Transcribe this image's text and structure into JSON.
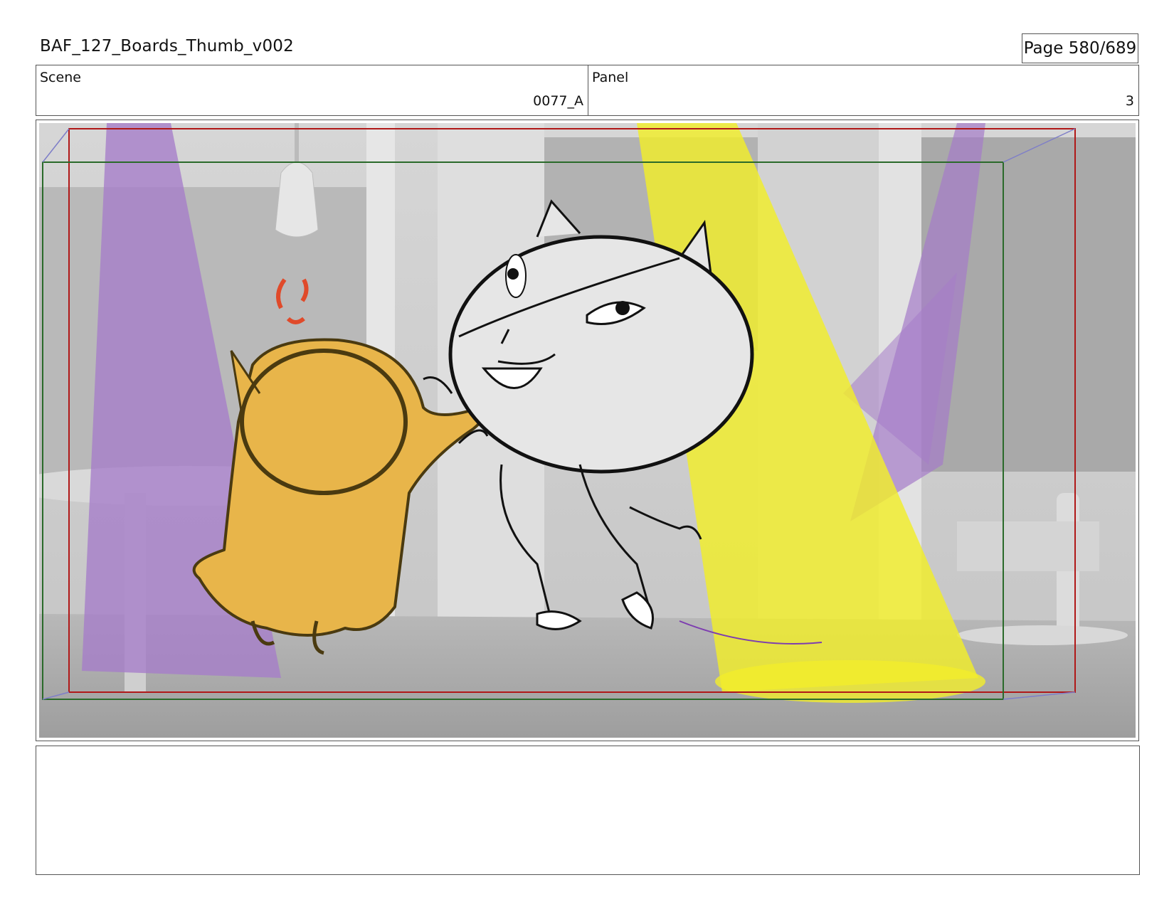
{
  "header": {
    "title": "BAF_127_Boards_Thumb_v002",
    "page": "Page 580/689"
  },
  "info": {
    "scene_label": "Scene",
    "scene_value": "0077_A",
    "panel_label": "Panel",
    "panel_value": "3"
  },
  "artwork": {
    "description_icon": "storyboard-sketch-icon",
    "colors": {
      "background_gray": "#c9c9c9",
      "purple_light": "#a57cc9",
      "yellow_light": "#f2ee2a",
      "orange_character": "#e8b54a",
      "safe_frame_red": "#b01818",
      "title_safe_green": "#2a6a2a",
      "camera_lines": "#7e7ec8"
    }
  },
  "notes": {
    "text": ""
  }
}
